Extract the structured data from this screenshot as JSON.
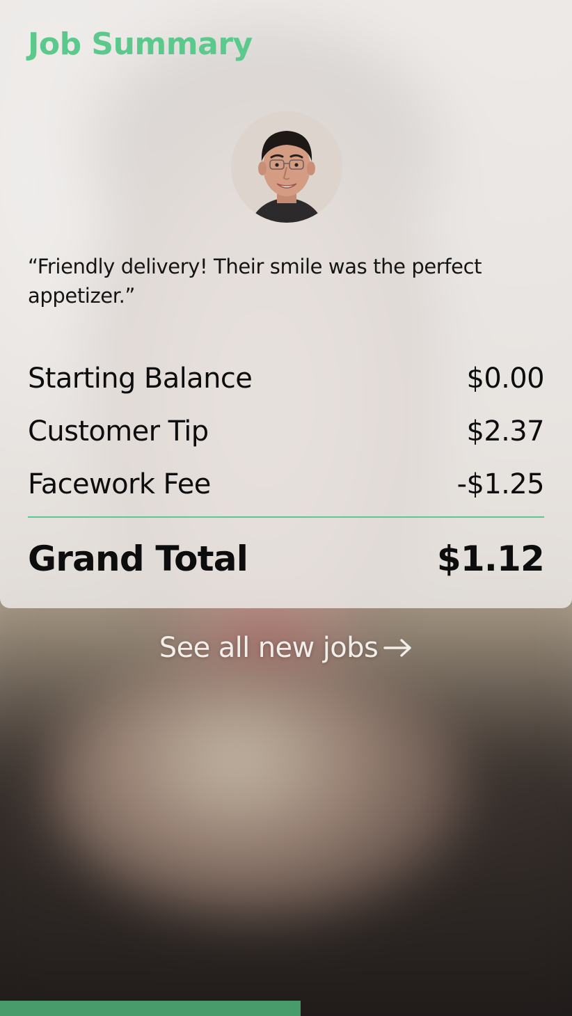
{
  "card": {
    "title": "Job Summary",
    "review": "“Friendly delivery! Their smile was the perfect appetizer.”",
    "avatar_icon": "person-avatar",
    "rows": [
      {
        "label": "Starting Balance",
        "value": "$0.00"
      },
      {
        "label": "Customer Tip",
        "value": "$2.37"
      },
      {
        "label": "Facework Fee",
        "value": "-$1.25"
      }
    ],
    "total": {
      "label": "Grand Total",
      "value": "$1.12"
    }
  },
  "link": {
    "label": "See all new jobs",
    "icon": "arrow-right-icon"
  },
  "progress": {
    "fraction": 0.525
  },
  "colors": {
    "accent": "#5bc98c",
    "progress": "#489b6b",
    "text": "#0d0d0d"
  }
}
